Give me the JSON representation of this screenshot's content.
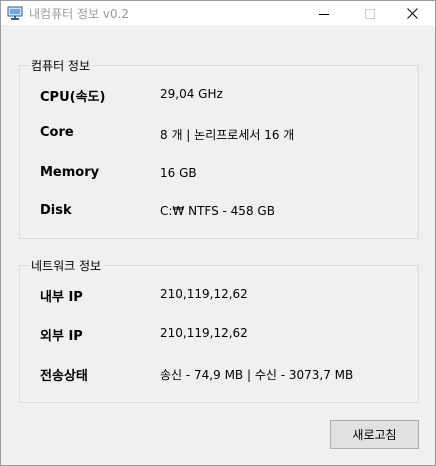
{
  "window": {
    "title": "내컴퓨터 정보 v0.2",
    "app_icon": "computer-monitor-icon",
    "controls": {
      "minimize": "minimize-icon",
      "maximize": "maximize-icon",
      "close": "close-icon"
    }
  },
  "computer_info": {
    "legend": "컴퓨터 정보",
    "rows": [
      {
        "label": "CPU(속도)",
        "value": "29,04 GHz"
      },
      {
        "label": "Core",
        "value": "8 개 | 논리프로세서 16 개"
      },
      {
        "label": "Memory",
        "value": "16 GB"
      },
      {
        "label": "Disk",
        "value": "C:₩ NTFS - 458 GB"
      }
    ]
  },
  "network_info": {
    "legend": "네트워크 정보",
    "rows": [
      {
        "label": "내부 IP",
        "value": "210,119,12,62"
      },
      {
        "label": "외부 IP",
        "value": "210,119,12,62"
      },
      {
        "label": "전송상태",
        "value": "송신 - 74,9 MB | 수신 - 3073,7 MB"
      }
    ]
  },
  "actions": {
    "refresh_label": "새로고침"
  }
}
